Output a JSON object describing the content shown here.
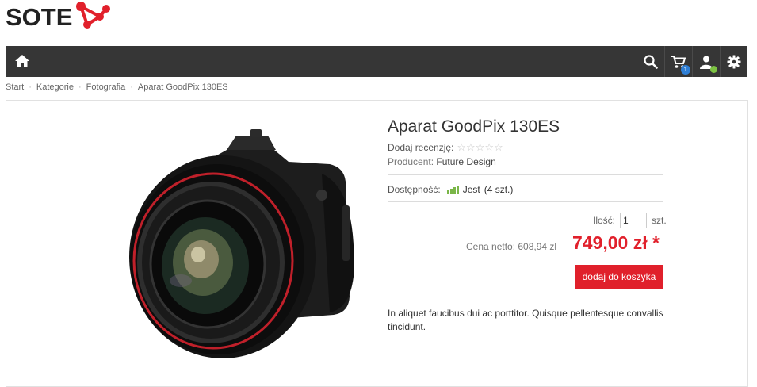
{
  "logo": {
    "text": "SOTE"
  },
  "nav": {
    "cart_count": "1",
    "icons": [
      "home-icon",
      "search-icon",
      "cart-icon",
      "user-icon",
      "gear-icon"
    ]
  },
  "breadcrumb": {
    "sep": "·",
    "items": [
      "Start",
      "Kategorie",
      "Fotografia",
      "Aparat GoodPix 130ES"
    ]
  },
  "product": {
    "title": "Aparat GoodPix 130ES",
    "review_label": "Dodaj recenzję:",
    "stars": "☆☆☆☆☆",
    "producer_label": "Producent:",
    "producer_name": "Future Design",
    "availability_label": "Dostępność:",
    "availability_value": "Jest",
    "availability_count": "(4 szt.)",
    "qty_label": "Ilość:",
    "qty_value": "1",
    "qty_unit": "szt.",
    "netto": "Cena netto: 608,94 zł",
    "price": "749,00 zł *",
    "add_to_cart": "dodaj do koszyka",
    "description": "In aliquet faucibus dui ac porttitor. Quisque pellentesque convallis tincidunt."
  },
  "colors": {
    "accent": "#e0202b",
    "navbar": "#363636",
    "availability": "#7ab648",
    "badge": "#2f7fd6"
  }
}
